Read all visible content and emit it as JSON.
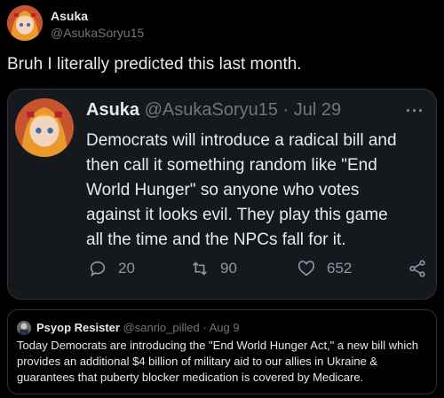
{
  "tweet": {
    "author_name": "Asuka",
    "author_handle": "@AsukaSoryu15",
    "text": "Bruh I literally predicted this last month."
  },
  "quoted": {
    "author_name": "Asuka",
    "author_handle": "@AsukaSoryu15",
    "separator": "·",
    "date": "Jul 29",
    "more": "···",
    "text": "Democrats will introduce a radical bill and then call it something random like \"End World Hunger\" so anyone who votes against it looks evil. They play this game all the time and the NPCs fall for it.",
    "replies": "20",
    "retweets": "90",
    "likes": "652"
  },
  "nested": {
    "author_name": "Psyop Resister",
    "author_handle": "@sanrio_pilled",
    "separator": "·",
    "date": "Aug 9",
    "text": "Today Democrats are introducing the \"End World Hunger Act,\" a new bill which provides an additional $4 billion of military aid to our allies in Ukraine & guarantees that puberty blocker medication is covered by Medicare."
  },
  "icons": [
    "reply-icon",
    "retweet-icon",
    "like-icon",
    "share-icon",
    "more-icon"
  ]
}
